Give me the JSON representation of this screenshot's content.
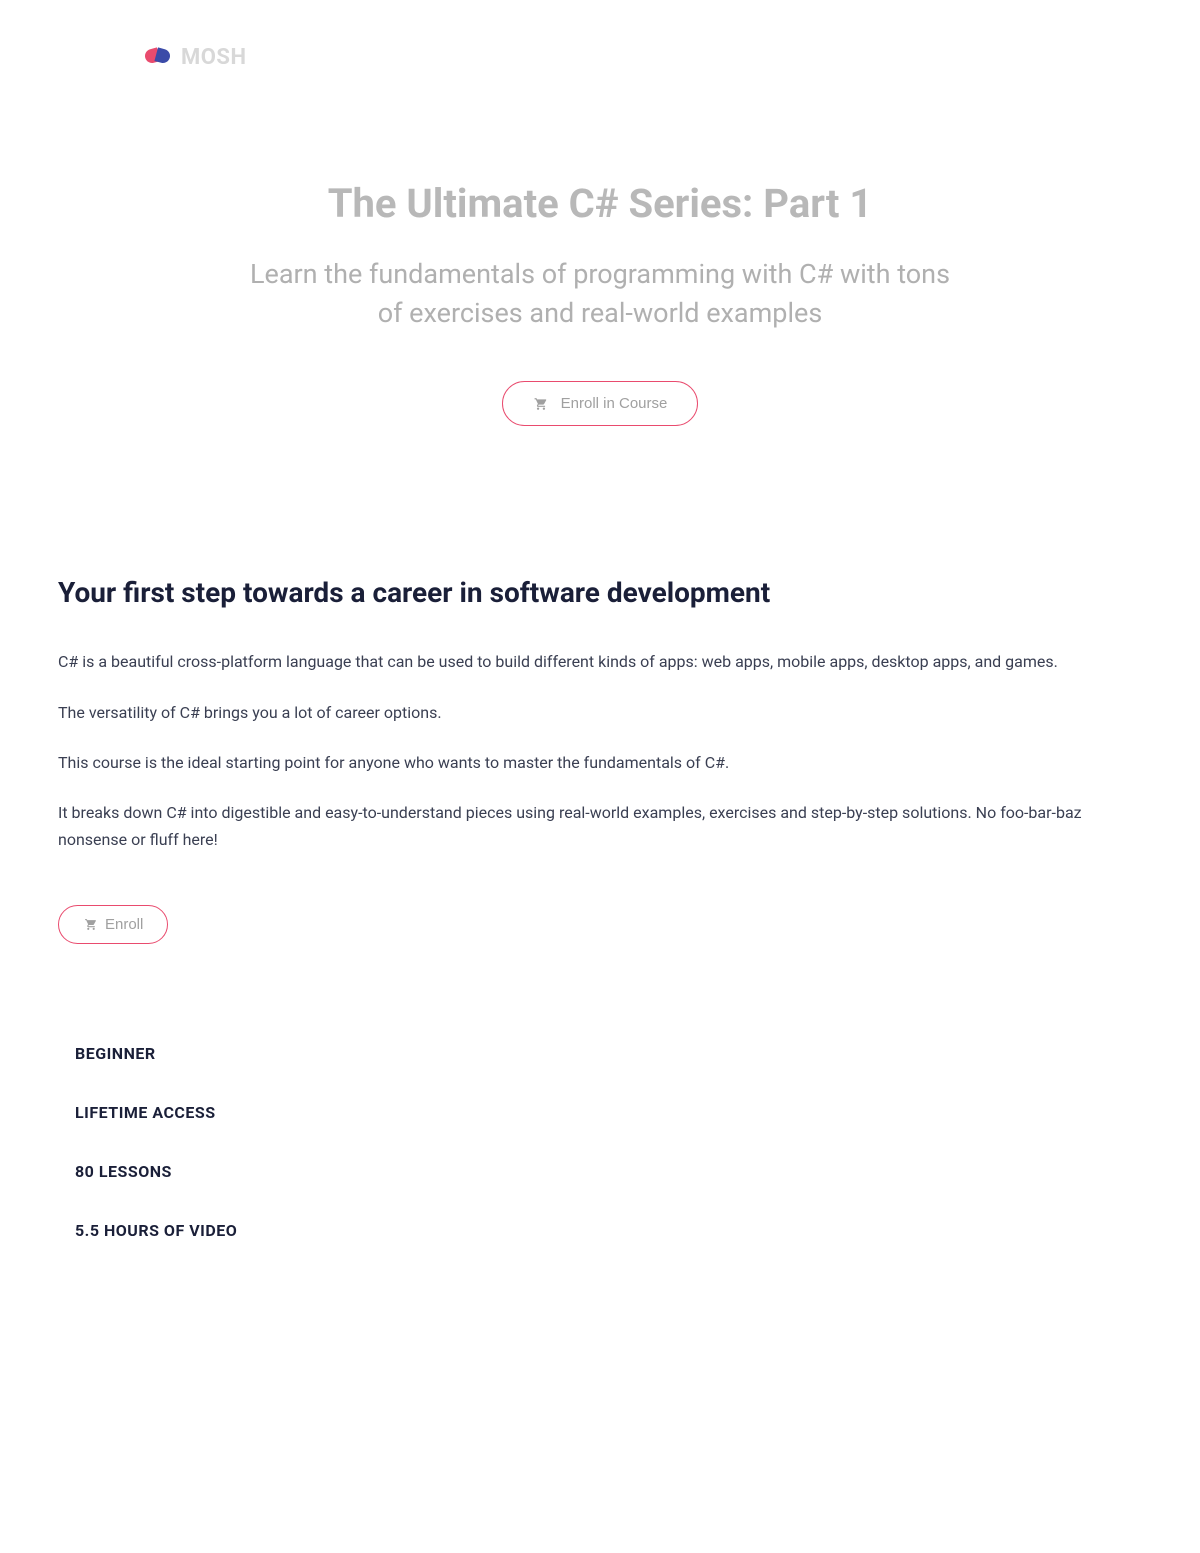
{
  "logo": {
    "text": "MOSH"
  },
  "hero": {
    "title": "The Ultimate C# Series: Part 1",
    "subtitle": "Learn the fundamentals of programming with C# with tons of exercises and real-world examples",
    "enrollLabel": "Enroll in Course"
  },
  "section": {
    "heading": "Your first step towards a career in software development",
    "paragraphs": [
      "C# is a beautiful cross-platform language that can be used to build different kinds of apps: web apps, mobile apps, desktop apps, and games.",
      "The versatility of C# brings you a lot of career options.",
      "This course is the ideal starting point for anyone who wants to master the fundamentals of C#.",
      "It breaks down C# into digestible and easy-to-understand pieces using real-world examples, exercises and step-by-step solutions. No foo-bar-baz nonsense or fluff here!"
    ],
    "enrollLabel": "Enroll"
  },
  "features": [
    "BEGINNER",
    "LIFETIME ACCESS",
    "80 LESSONS",
    "5.5 HOURS OF VIDEO"
  ]
}
